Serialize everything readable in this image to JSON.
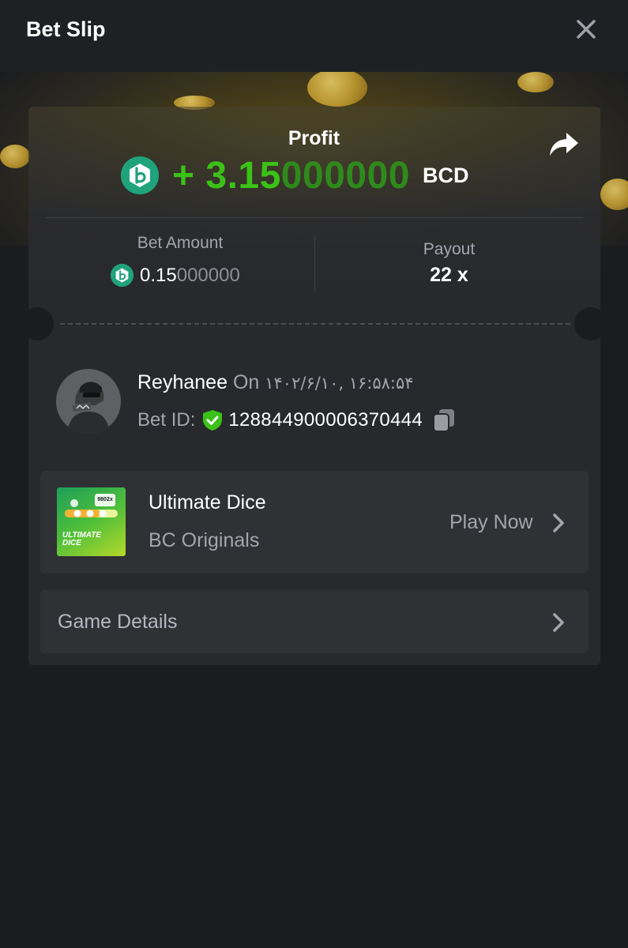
{
  "header": {
    "title": "Bet Slip",
    "close_icon": "close-icon"
  },
  "profit": {
    "label": "Profit",
    "sign": "+ ",
    "value_main": "3.15",
    "value_trailing": "000000",
    "currency": "BCD",
    "share_icon": "share-icon"
  },
  "bet": {
    "amount_label": "Bet Amount",
    "amount_main": "0.15",
    "amount_trailing": "000000",
    "payout_label": "Payout",
    "payout_value": "22 x"
  },
  "user": {
    "name": "Reyhanee",
    "on_text": "On",
    "datetime": "۱۴۰۲/۶/۱۰, ۱۶:۵۸:۵۴",
    "bet_id_label": "Bet ID:",
    "bet_id": "128844900006370444"
  },
  "game": {
    "name": "Ultimate Dice",
    "provider": "BC Originals",
    "action_label": "Play Now",
    "thumb_line1": "ULTIMATE",
    "thumb_line2": "DICE",
    "thumb_badge": "9802x"
  },
  "details": {
    "label": "Game Details"
  },
  "colors": {
    "background": "#1b1c1f",
    "card": "#27292d",
    "row": "#2f3135",
    "profit_green": "#3bc117",
    "bcd_teal": "#1fa37b",
    "muted_text": "#a2a7ae"
  }
}
